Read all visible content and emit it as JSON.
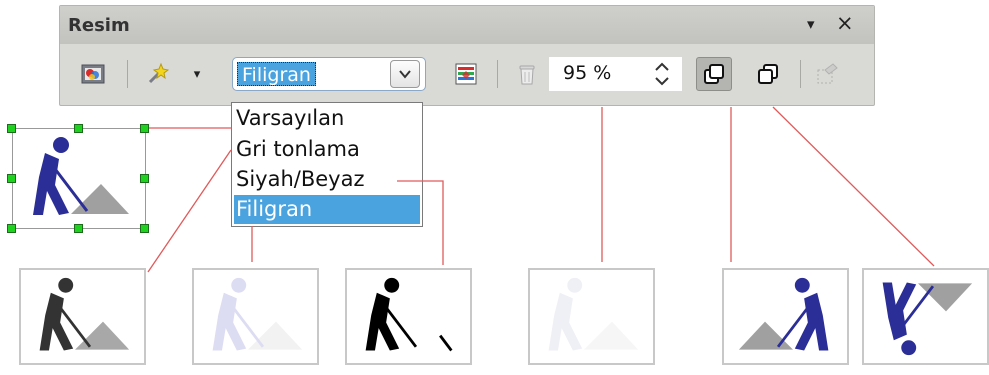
{
  "toolbar": {
    "title": "Resim",
    "menu_glyph": "▾",
    "close_glyph": "×",
    "graphics_mode": {
      "selected": "Filigran",
      "options": [
        "Varsayılan",
        "Gri tonlama",
        "Siyah/Beyaz",
        "Filigran"
      ]
    },
    "transparency": "95 %"
  },
  "icons": {
    "filter": "image-filter-icon",
    "effects": "magic-wand-icon",
    "effects_arrow": "chevron-down-icon",
    "color": "color-adjust-icon",
    "transparency": "trash-bin-icon",
    "stepper": "up-down-arrows-icon",
    "bring_forward": "bring-to-front-icon",
    "send_backward": "send-to-back-icon",
    "crop": "crop-icon"
  },
  "colors": {
    "accent_blue": "#4aa3df",
    "callout_red": "#e05a5a",
    "handle_green": "#1fd21f",
    "figure_blue": "#2b2e96",
    "dropdown_selection": "#4aa3df"
  }
}
